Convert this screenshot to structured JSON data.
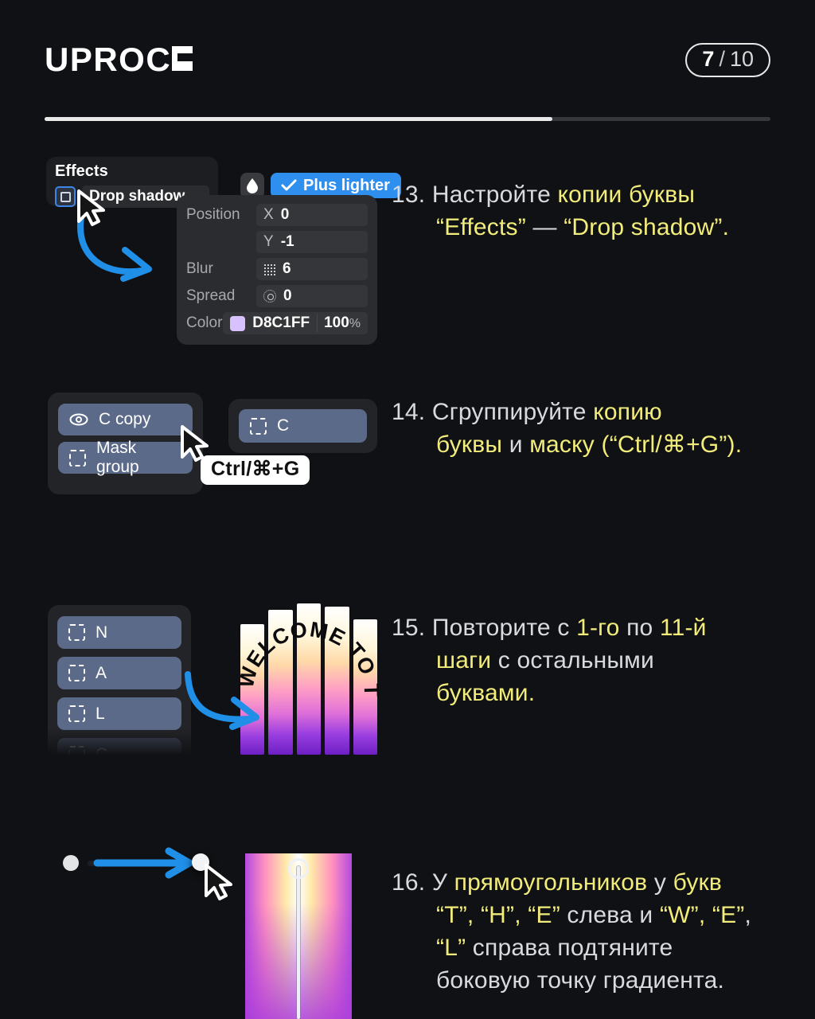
{
  "header": {
    "logo_text": "UPROC",
    "logo_mark": "k-mark",
    "badge_current": "7",
    "badge_separator": "/",
    "badge_total": "10",
    "progress_percent": 70
  },
  "colors": {
    "background": "#101114",
    "highlight_yellow": "#f2ec7a",
    "body_text": "#d9dade",
    "accent_blue": "#2f8fee",
    "layer_row": "#5b6a88",
    "shadow_color": "#D8C1FF"
  },
  "section13": {
    "effects_panel": {
      "title": "Effects",
      "effect_name": "Drop shadow",
      "checkbox_icon": "square-icon"
    },
    "blend_button": {
      "label": "Plus lighter",
      "check_icon": "check-icon"
    },
    "drop_icon": "droplet-icon",
    "fields": [
      {
        "label": "Position",
        "axis": "X",
        "value": "0",
        "icon": ""
      },
      {
        "label": "",
        "axis": "Y",
        "value": "-1",
        "icon": ""
      },
      {
        "label": "Blur",
        "axis": "",
        "value": "6",
        "icon": "grid-icon"
      },
      {
        "label": "Spread",
        "axis": "",
        "value": "0",
        "icon": "spread-icon"
      },
      {
        "label": "Color",
        "axis": "",
        "value": "D8C1FF",
        "icon": "color-swatch",
        "opacity": "100",
        "opacity_unit": "%"
      }
    ],
    "step": {
      "number": "13.",
      "line1_plain": "Настройте ",
      "line1_hl": "копии буквы",
      "line2_hl1": "“Effects”",
      "line2_dash": " — ",
      "line2_hl2": "“Drop shadow”",
      "line2_end": "."
    }
  },
  "section14": {
    "layers_left": [
      {
        "label": "C copy",
        "icon": "eye-icon"
      },
      {
        "label": "Mask group",
        "icon": "dashed-frame-icon"
      }
    ],
    "layers_right": [
      {
        "label": "C",
        "icon": "dashed-frame-icon"
      }
    ],
    "tooltip": "Ctrl/⌘+G",
    "step": {
      "number": "14.",
      "line1_plain": "Сгруппируйте ",
      "line1_hl": "копию",
      "line2_hl1": "буквы",
      "line2_mid": " и ",
      "line2_hl2": "маску",
      "line2_tail": " (“Ctrl/⌘+G”)."
    }
  },
  "section15": {
    "layers": [
      {
        "label": "N",
        "icon": "dashed-frame-icon"
      },
      {
        "label": "A",
        "icon": "dashed-frame-icon"
      },
      {
        "label": "L",
        "icon": "dashed-frame-icon"
      },
      {
        "label": "C",
        "icon": "dashed-frame-icon"
      }
    ],
    "artwork_text": "WELCOME TO THE CLAN",
    "step": {
      "number": "15.",
      "line1_plain": "Повторите с ",
      "line1_hl1": "1-го",
      "line1_mid": " по ",
      "line1_hl2": "11-й",
      "line2_hl": "шаги",
      "line2_plain": " с остальными",
      "line3_hl": "буквами",
      "line3_end": "."
    }
  },
  "section16": {
    "step": {
      "number": "16.",
      "l1_a": "У ",
      "l1_hl": "прямоугольников",
      "l1_b": " у ",
      "l1_hl2": "букв",
      "l2_hl1": "“T”, “H”, “E”",
      "l2_mid": " слева и ",
      "l2_hl2": "“W”, “E”",
      "l2_comma": ",",
      "l3_hl": "“L”",
      "l3_plain": " справа подтяните",
      "l4_plain": "боковую точку градиента."
    }
  }
}
